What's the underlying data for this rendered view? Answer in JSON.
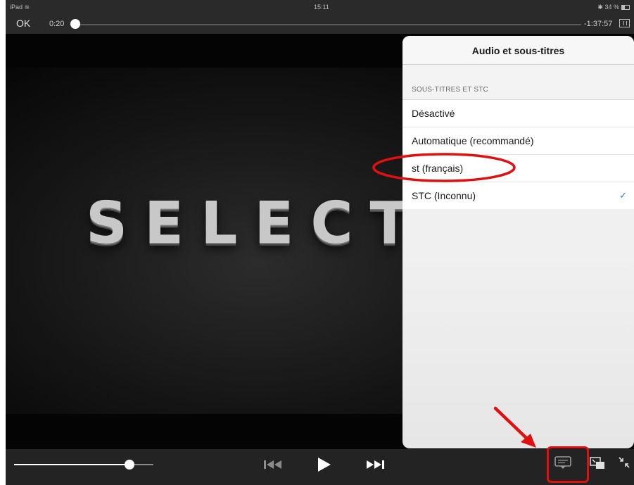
{
  "status_bar": {
    "device": "iPad",
    "time": "15:11",
    "battery": "34 %"
  },
  "scrubber": {
    "done_label": "OK",
    "elapsed": "0:20",
    "remaining": "-1:37:57",
    "progress": 0.004
  },
  "video": {
    "title_text": "SELECT"
  },
  "controls": {
    "volume": 0.83,
    "icons": [
      "volume-slider",
      "skip-back-icon",
      "play-icon",
      "skip-forward-icon",
      "subtitles-icon",
      "picture-in-picture-icon",
      "exit-fullscreen-icon"
    ]
  },
  "popover": {
    "title": "Audio et sous-titres",
    "section_label": "SOUS-TITRES ET STC",
    "options": [
      {
        "label": "Désactivé",
        "selected": false
      },
      {
        "label": "Automatique (recommandé)",
        "selected": false
      },
      {
        "label": "st (français)",
        "selected": false
      },
      {
        "label": "STC (Inconnu)",
        "selected": true
      }
    ],
    "check_mark": "✓"
  },
  "colors": {
    "accent": "#2a7de1",
    "annotation": "#e01010"
  }
}
